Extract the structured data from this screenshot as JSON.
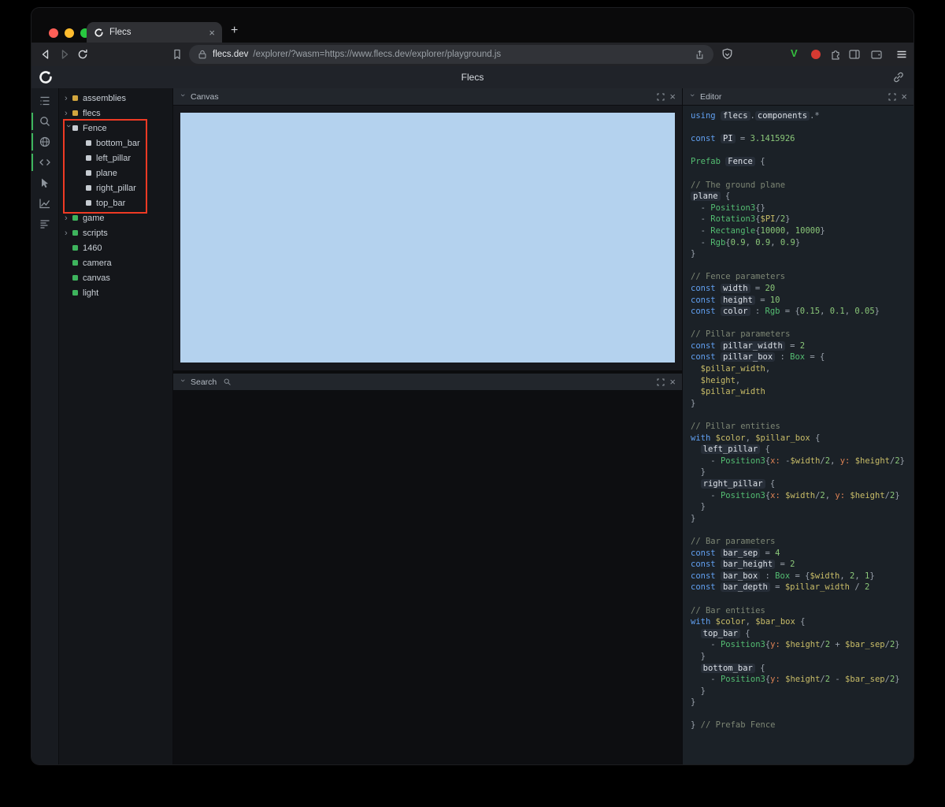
{
  "colors": {
    "accent_green": "#3eb45d",
    "annotation_red": "#ee3a24",
    "canvas_blue": "#b4d2ee"
  },
  "browser": {
    "tab_title": "Flecs",
    "tab_close_label": "×",
    "new_tab_label": "+",
    "url_host": "flecs.dev",
    "url_path": "/explorer/?wasm=https://www.flecs.dev/explorer/playground.js",
    "brave_v_label": "V"
  },
  "app": {
    "title": "Flecs"
  },
  "panels": {
    "canvas": {
      "title": "Canvas"
    },
    "search": {
      "title": "Search"
    },
    "editor": {
      "title": "Editor"
    }
  },
  "tree": {
    "items": [
      {
        "label": "assemblies",
        "color": "yellow",
        "state": "closed",
        "depth": 0
      },
      {
        "label": "flecs",
        "color": "yellow",
        "state": "closed",
        "depth": 0
      },
      {
        "label": "Fence",
        "color": "gray",
        "state": "open",
        "depth": 0
      },
      {
        "label": "bottom_bar",
        "color": "gray",
        "state": "",
        "depth": 1
      },
      {
        "label": "left_pillar",
        "color": "gray",
        "state": "",
        "depth": 1
      },
      {
        "label": "plane",
        "color": "gray",
        "state": "",
        "depth": 1
      },
      {
        "label": "right_pillar",
        "color": "gray",
        "state": "",
        "depth": 1
      },
      {
        "label": "top_bar",
        "color": "gray",
        "state": "",
        "depth": 1
      },
      {
        "label": "game",
        "color": "green",
        "state": "closed",
        "depth": 0
      },
      {
        "label": "scripts",
        "color": "green",
        "state": "closed",
        "depth": 0
      },
      {
        "label": "1460",
        "color": "green",
        "state": "",
        "depth": 0
      },
      {
        "label": "camera",
        "color": "green",
        "state": "",
        "depth": 0
      },
      {
        "label": "canvas",
        "color": "green",
        "state": "",
        "depth": 0
      },
      {
        "label": "light",
        "color": "green",
        "state": "",
        "depth": 0
      }
    ]
  },
  "editor": {
    "lines": [
      [
        [
          "k",
          "using"
        ],
        [
          "p",
          " "
        ],
        [
          "i",
          "flecs"
        ],
        [
          "p",
          "."
        ],
        [
          "i",
          "components"
        ],
        [
          "p",
          ".*"
        ]
      ],
      [],
      [
        [
          "k",
          "const"
        ],
        [
          "p",
          " "
        ],
        [
          "i",
          "PI"
        ],
        [
          "p",
          " = "
        ],
        [
          "n",
          "3.1415926"
        ]
      ],
      [],
      [
        [
          "g",
          "Prefab"
        ],
        [
          "p",
          " "
        ],
        [
          "i",
          "Fence"
        ],
        [
          "p",
          " {"
        ]
      ],
      [],
      [
        [
          "c",
          "// The ground plane"
        ]
      ],
      [
        [
          "i",
          "plane"
        ],
        [
          "p",
          " {"
        ]
      ],
      [
        [
          "p",
          "  - "
        ],
        [
          "g",
          "Position3"
        ],
        [
          "p",
          "{}"
        ]
      ],
      [
        [
          "p",
          "  - "
        ],
        [
          "g",
          "Rotation3"
        ],
        [
          "p",
          "{"
        ],
        [
          "v",
          "$PI"
        ],
        [
          "p",
          "/"
        ],
        [
          "n",
          "2"
        ],
        [
          "p",
          "}"
        ]
      ],
      [
        [
          "p",
          "  - "
        ],
        [
          "g",
          "Rectangle"
        ],
        [
          "p",
          "{"
        ],
        [
          "n",
          "10000"
        ],
        [
          "p",
          ", "
        ],
        [
          "n",
          "10000"
        ],
        [
          "p",
          "}"
        ]
      ],
      [
        [
          "p",
          "  - "
        ],
        [
          "g",
          "Rgb"
        ],
        [
          "p",
          "{"
        ],
        [
          "n",
          "0.9"
        ],
        [
          "p",
          ", "
        ],
        [
          "n",
          "0.9"
        ],
        [
          "p",
          ", "
        ],
        [
          "n",
          "0.9"
        ],
        [
          "p",
          "}"
        ]
      ],
      [
        [
          "p",
          "}"
        ]
      ],
      [],
      [
        [
          "c",
          "// Fence parameters"
        ]
      ],
      [
        [
          "k",
          "const"
        ],
        [
          "p",
          " "
        ],
        [
          "i",
          "width"
        ],
        [
          "p",
          " = "
        ],
        [
          "n",
          "20"
        ]
      ],
      [
        [
          "k",
          "const"
        ],
        [
          "p",
          " "
        ],
        [
          "i",
          "height"
        ],
        [
          "p",
          " = "
        ],
        [
          "n",
          "10"
        ]
      ],
      [
        [
          "k",
          "const"
        ],
        [
          "p",
          " "
        ],
        [
          "i",
          "color"
        ],
        [
          "p",
          " : "
        ],
        [
          "g",
          "Rgb"
        ],
        [
          "p",
          " = {"
        ],
        [
          "n",
          "0.15"
        ],
        [
          "p",
          ", "
        ],
        [
          "n",
          "0.1"
        ],
        [
          "p",
          ", "
        ],
        [
          "n",
          "0.05"
        ],
        [
          "p",
          "}"
        ]
      ],
      [],
      [
        [
          "c",
          "// Pillar parameters"
        ]
      ],
      [
        [
          "k",
          "const"
        ],
        [
          "p",
          " "
        ],
        [
          "i",
          "pillar_width"
        ],
        [
          "p",
          " = "
        ],
        [
          "n",
          "2"
        ]
      ],
      [
        [
          "k",
          "const"
        ],
        [
          "p",
          " "
        ],
        [
          "i",
          "pillar_box"
        ],
        [
          "p",
          " : "
        ],
        [
          "g",
          "Box"
        ],
        [
          "p",
          " = {"
        ]
      ],
      [
        [
          "p",
          "  "
        ],
        [
          "v",
          "$pillar_width"
        ],
        [
          "p",
          ","
        ]
      ],
      [
        [
          "p",
          "  "
        ],
        [
          "v",
          "$height"
        ],
        [
          "p",
          ","
        ]
      ],
      [
        [
          "p",
          "  "
        ],
        [
          "v",
          "$pillar_width"
        ]
      ],
      [
        [
          "p",
          "}"
        ]
      ],
      [],
      [
        [
          "c",
          "// Pillar entities"
        ]
      ],
      [
        [
          "k",
          "with"
        ],
        [
          "p",
          " "
        ],
        [
          "v",
          "$color"
        ],
        [
          "p",
          ", "
        ],
        [
          "v",
          "$pillar_box"
        ],
        [
          "p",
          " {"
        ]
      ],
      [
        [
          "p",
          "  "
        ],
        [
          "i",
          "left_pillar"
        ],
        [
          "p",
          " {"
        ]
      ],
      [
        [
          "p",
          "    - "
        ],
        [
          "g",
          "Position3"
        ],
        [
          "p",
          "{"
        ],
        [
          "m",
          "x:"
        ],
        [
          "p",
          " -"
        ],
        [
          "v",
          "$width"
        ],
        [
          "p",
          "/"
        ],
        [
          "n",
          "2"
        ],
        [
          "p",
          ", "
        ],
        [
          "m",
          "y:"
        ],
        [
          "p",
          " "
        ],
        [
          "v",
          "$height"
        ],
        [
          "p",
          "/"
        ],
        [
          "n",
          "2"
        ],
        [
          "p",
          "}"
        ]
      ],
      [
        [
          "p",
          "  }"
        ]
      ],
      [
        [
          "p",
          "  "
        ],
        [
          "i",
          "right_pillar"
        ],
        [
          "p",
          " {"
        ]
      ],
      [
        [
          "p",
          "    - "
        ],
        [
          "g",
          "Position3"
        ],
        [
          "p",
          "{"
        ],
        [
          "m",
          "x:"
        ],
        [
          "p",
          " "
        ],
        [
          "v",
          "$width"
        ],
        [
          "p",
          "/"
        ],
        [
          "n",
          "2"
        ],
        [
          "p",
          ", "
        ],
        [
          "m",
          "y:"
        ],
        [
          "p",
          " "
        ],
        [
          "v",
          "$height"
        ],
        [
          "p",
          "/"
        ],
        [
          "n",
          "2"
        ],
        [
          "p",
          "}"
        ]
      ],
      [
        [
          "p",
          "  }"
        ]
      ],
      [
        [
          "p",
          "}"
        ]
      ],
      [],
      [
        [
          "c",
          "// Bar parameters"
        ]
      ],
      [
        [
          "k",
          "const"
        ],
        [
          "p",
          " "
        ],
        [
          "i",
          "bar_sep"
        ],
        [
          "p",
          " = "
        ],
        [
          "n",
          "4"
        ]
      ],
      [
        [
          "k",
          "const"
        ],
        [
          "p",
          " "
        ],
        [
          "i",
          "bar_height"
        ],
        [
          "p",
          " = "
        ],
        [
          "n",
          "2"
        ]
      ],
      [
        [
          "k",
          "const"
        ],
        [
          "p",
          " "
        ],
        [
          "i",
          "bar_box"
        ],
        [
          "p",
          " : "
        ],
        [
          "g",
          "Box"
        ],
        [
          "p",
          " = {"
        ],
        [
          "v",
          "$width"
        ],
        [
          "p",
          ", "
        ],
        [
          "n",
          "2"
        ],
        [
          "p",
          ", "
        ],
        [
          "n",
          "1"
        ],
        [
          "p",
          "}"
        ]
      ],
      [
        [
          "k",
          "const"
        ],
        [
          "p",
          " "
        ],
        [
          "i",
          "bar_depth"
        ],
        [
          "p",
          " = "
        ],
        [
          "v",
          "$pillar_width"
        ],
        [
          "p",
          " / "
        ],
        [
          "n",
          "2"
        ]
      ],
      [],
      [
        [
          "c",
          "// Bar entities"
        ]
      ],
      [
        [
          "k",
          "with"
        ],
        [
          "p",
          " "
        ],
        [
          "v",
          "$color"
        ],
        [
          "p",
          ", "
        ],
        [
          "v",
          "$bar_box"
        ],
        [
          "p",
          " {"
        ]
      ],
      [
        [
          "p",
          "  "
        ],
        [
          "i",
          "top_bar"
        ],
        [
          "p",
          " {"
        ]
      ],
      [
        [
          "p",
          "    - "
        ],
        [
          "g",
          "Position3"
        ],
        [
          "p",
          "{"
        ],
        [
          "m",
          "y:"
        ],
        [
          "p",
          " "
        ],
        [
          "v",
          "$height"
        ],
        [
          "p",
          "/"
        ],
        [
          "n",
          "2"
        ],
        [
          "p",
          " + "
        ],
        [
          "v",
          "$bar_sep"
        ],
        [
          "p",
          "/"
        ],
        [
          "n",
          "2"
        ],
        [
          "p",
          "}"
        ]
      ],
      [
        [
          "p",
          "  }"
        ]
      ],
      [
        [
          "p",
          "  "
        ],
        [
          "i",
          "bottom_bar"
        ],
        [
          "p",
          " {"
        ]
      ],
      [
        [
          "p",
          "    - "
        ],
        [
          "g",
          "Position3"
        ],
        [
          "p",
          "{"
        ],
        [
          "m",
          "y:"
        ],
        [
          "p",
          " "
        ],
        [
          "v",
          "$height"
        ],
        [
          "p",
          "/"
        ],
        [
          "n",
          "2"
        ],
        [
          "p",
          " - "
        ],
        [
          "v",
          "$bar_sep"
        ],
        [
          "p",
          "/"
        ],
        [
          "n",
          "2"
        ],
        [
          "p",
          "}"
        ]
      ],
      [
        [
          "p",
          "  }"
        ]
      ],
      [
        [
          "p",
          "}"
        ]
      ],
      [],
      [
        [
          "p",
          "} "
        ],
        [
          "c",
          "// Prefab Fence"
        ]
      ]
    ]
  }
}
